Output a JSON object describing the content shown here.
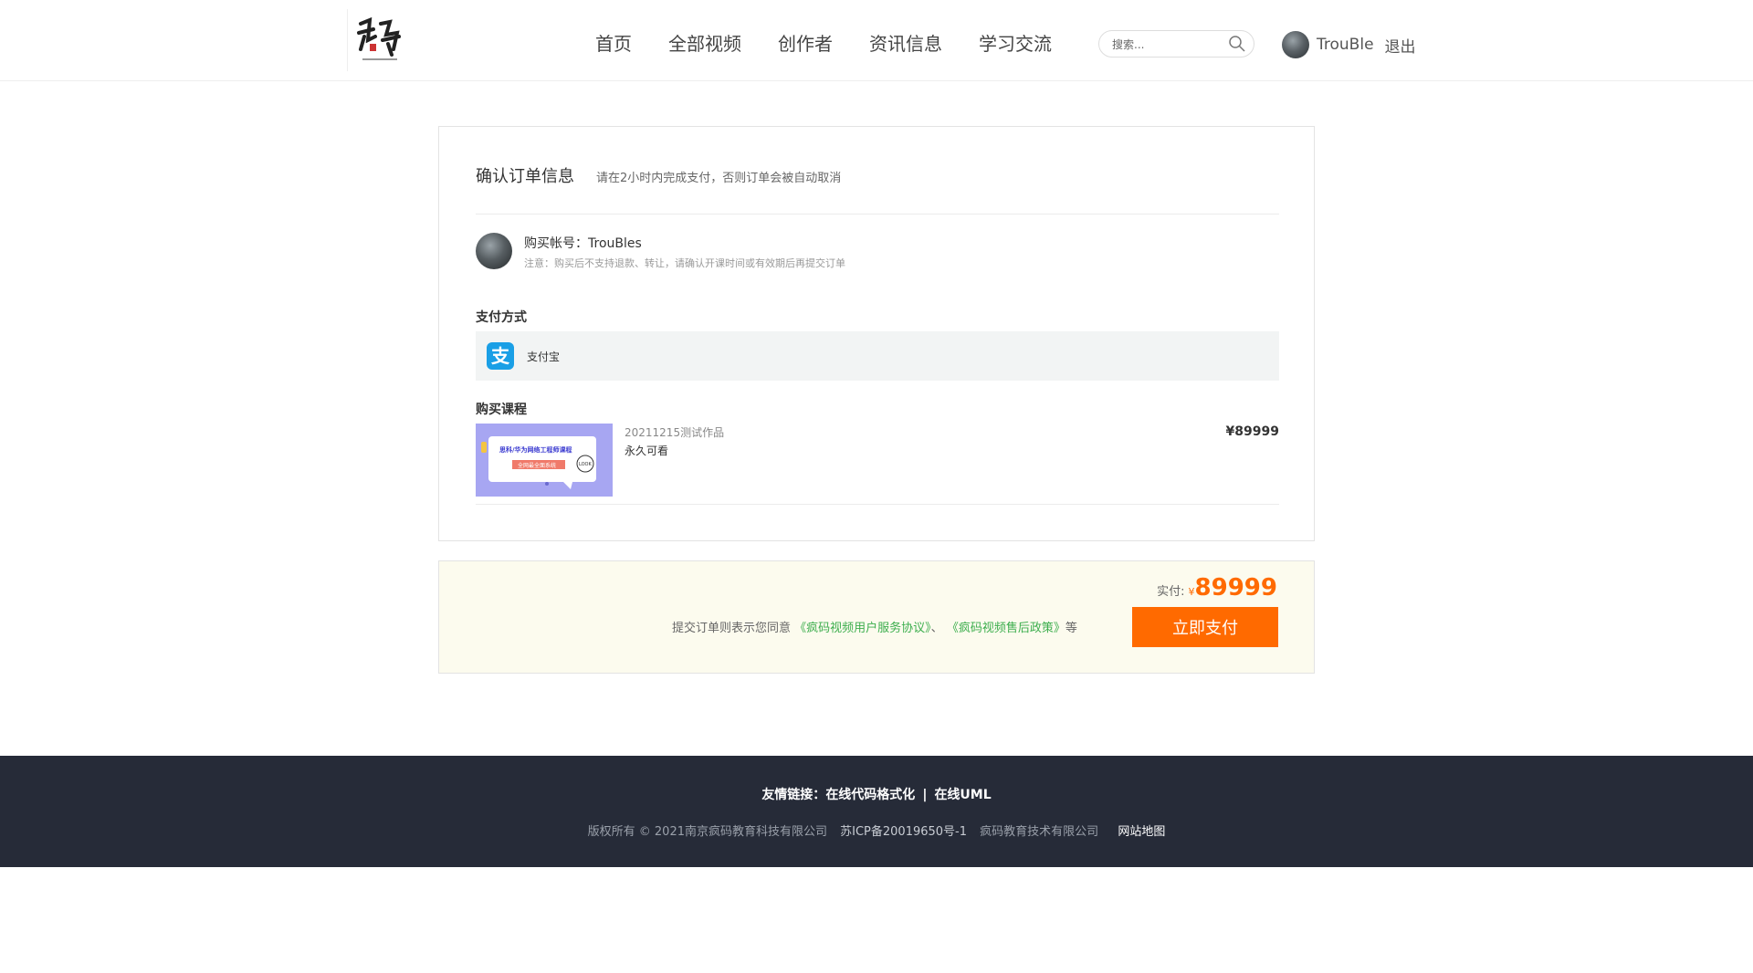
{
  "header": {
    "nav": [
      "首页",
      "全部视频",
      "创作者",
      "资讯信息",
      "学习交流"
    ],
    "search_placeholder": "搜索...",
    "username": "TrouBle",
    "logout": "退出"
  },
  "order": {
    "title": "确认订单信息",
    "subtitle": "请在2小时内完成支付，否则订单会被自动取消",
    "account_label": "购买帐号：",
    "account_name": "TrouBles",
    "note": "注意：购买后不支持退款、转让，请确认开课时间或有效期后再提交订单",
    "payment_label": "支付方式",
    "payment_icon_glyph": "支",
    "payment_method": "支付宝",
    "course_label": "购买课程",
    "course": {
      "name": "20211215测试作品",
      "term": "永久可看",
      "price": "¥89999",
      "thumb_title": "思科/华为网络工程师课程",
      "thumb_sub": "全网最全面系统",
      "thumb_badge": "LOOK"
    }
  },
  "checkout": {
    "total_label": "实付:",
    "currency": "¥",
    "total": "89999",
    "agree_prefix": "提交订单则表示您同意",
    "agree_link1": "《疯码视频用户服务协议》",
    "agree_sep": "、",
    "agree_link2": "《疯码视频售后政策》",
    "agree_suffix": "等",
    "pay_button": "立即支付"
  },
  "footer": {
    "links_label": "友情链接：",
    "link1": "在线代码格式化",
    "link_sep": "|",
    "link2": "在线UML",
    "copyright": "版权所有 © 2021南京疯码教育科技有限公司",
    "icp": "苏ICP备20019650号-1",
    "company": "疯码教育技术有限公司",
    "sitemap": "网站地图"
  },
  "colors": {
    "accent": "#ff6a00",
    "link_green": "#3cae4d",
    "footer_bg": "#262b38",
    "alipay_blue": "#1a9fe6",
    "checkout_bg": "#fcfbee"
  }
}
